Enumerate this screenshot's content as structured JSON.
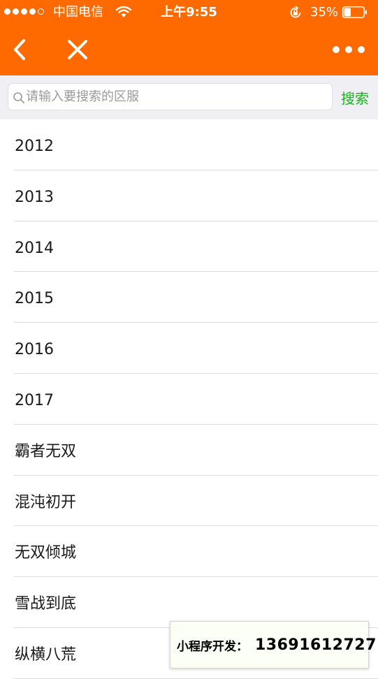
{
  "status_bar": {
    "carrier": "中国电信",
    "time": "上午9:55",
    "battery": "35%",
    "battery_level": 0.35
  },
  "nav": {
    "back_icon": "chevron-left-icon",
    "close_icon": "close-icon",
    "more_icon": "more-dots-icon"
  },
  "search": {
    "placeholder": "请输入要搜索的区服",
    "value": "",
    "button_label": "搜索"
  },
  "servers": [
    "2012",
    "2013",
    "2014",
    "2015",
    "2016",
    "2017",
    "霸者无双",
    "混沌初开",
    "无双倾城",
    "雪战到底",
    "纵横八荒"
  ],
  "banner": {
    "label": "小程序开发：",
    "phone": "13691612727"
  },
  "colors": {
    "accent": "#ff6a00",
    "search_button": "#18b31e"
  }
}
